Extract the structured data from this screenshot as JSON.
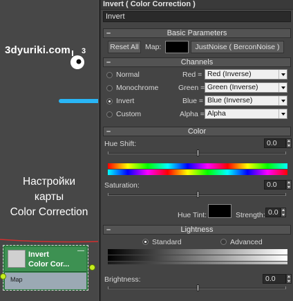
{
  "watermark": {
    "site": "3dyuriki.com",
    "caption_lines": [
      "Настройки",
      "карты",
      "Color Correction"
    ]
  },
  "node": {
    "title_line1": "Invert",
    "title_line2": "Color Cor...",
    "minimize": "—",
    "slot_label": "Map"
  },
  "panel": {
    "title": "Invert  ( Color Correction )",
    "name_value": "Invert",
    "basic": {
      "header": "Basic Parameters",
      "reset_label": "Reset All",
      "map_label": "Map:",
      "map_button_label": "JustNoise  ( BerconNoise )"
    },
    "channels": {
      "header": "Channels",
      "modes": [
        {
          "label": "Normal",
          "selected": false
        },
        {
          "label": "Monochrome",
          "selected": false
        },
        {
          "label": "Invert",
          "selected": true
        },
        {
          "label": "Custom",
          "selected": false
        }
      ],
      "rows": [
        {
          "label": "Red =",
          "value": "Red (Inverse)"
        },
        {
          "label": "Green =",
          "value": "Green (Inverse)"
        },
        {
          "label": "Blue =",
          "value": "Blue (Inverse)"
        },
        {
          "label": "Alpha =",
          "value": "Alpha"
        }
      ]
    },
    "color": {
      "header": "Color",
      "hue_shift_label": "Hue Shift:",
      "hue_shift_value": "0.0",
      "saturation_label": "Saturation:",
      "saturation_value": "0.0",
      "hue_tint_label": "Hue Tint:",
      "strength_label": "Strength:",
      "strength_value": "0.0",
      "hue_tint_color": "#000000"
    },
    "lightness": {
      "header": "Lightness",
      "standard_label": "Standard",
      "standard_selected": true,
      "advanced_label": "Advanced",
      "advanced_selected": false,
      "brightness_label": "Brightness:",
      "brightness_value": "0.0"
    }
  },
  "colors": {
    "panel_bg": "#444444",
    "node_green": "#3d9152",
    "arrow": "#29b6f6",
    "socket": "#c6ef1e",
    "red_line": "#d32f2f"
  }
}
